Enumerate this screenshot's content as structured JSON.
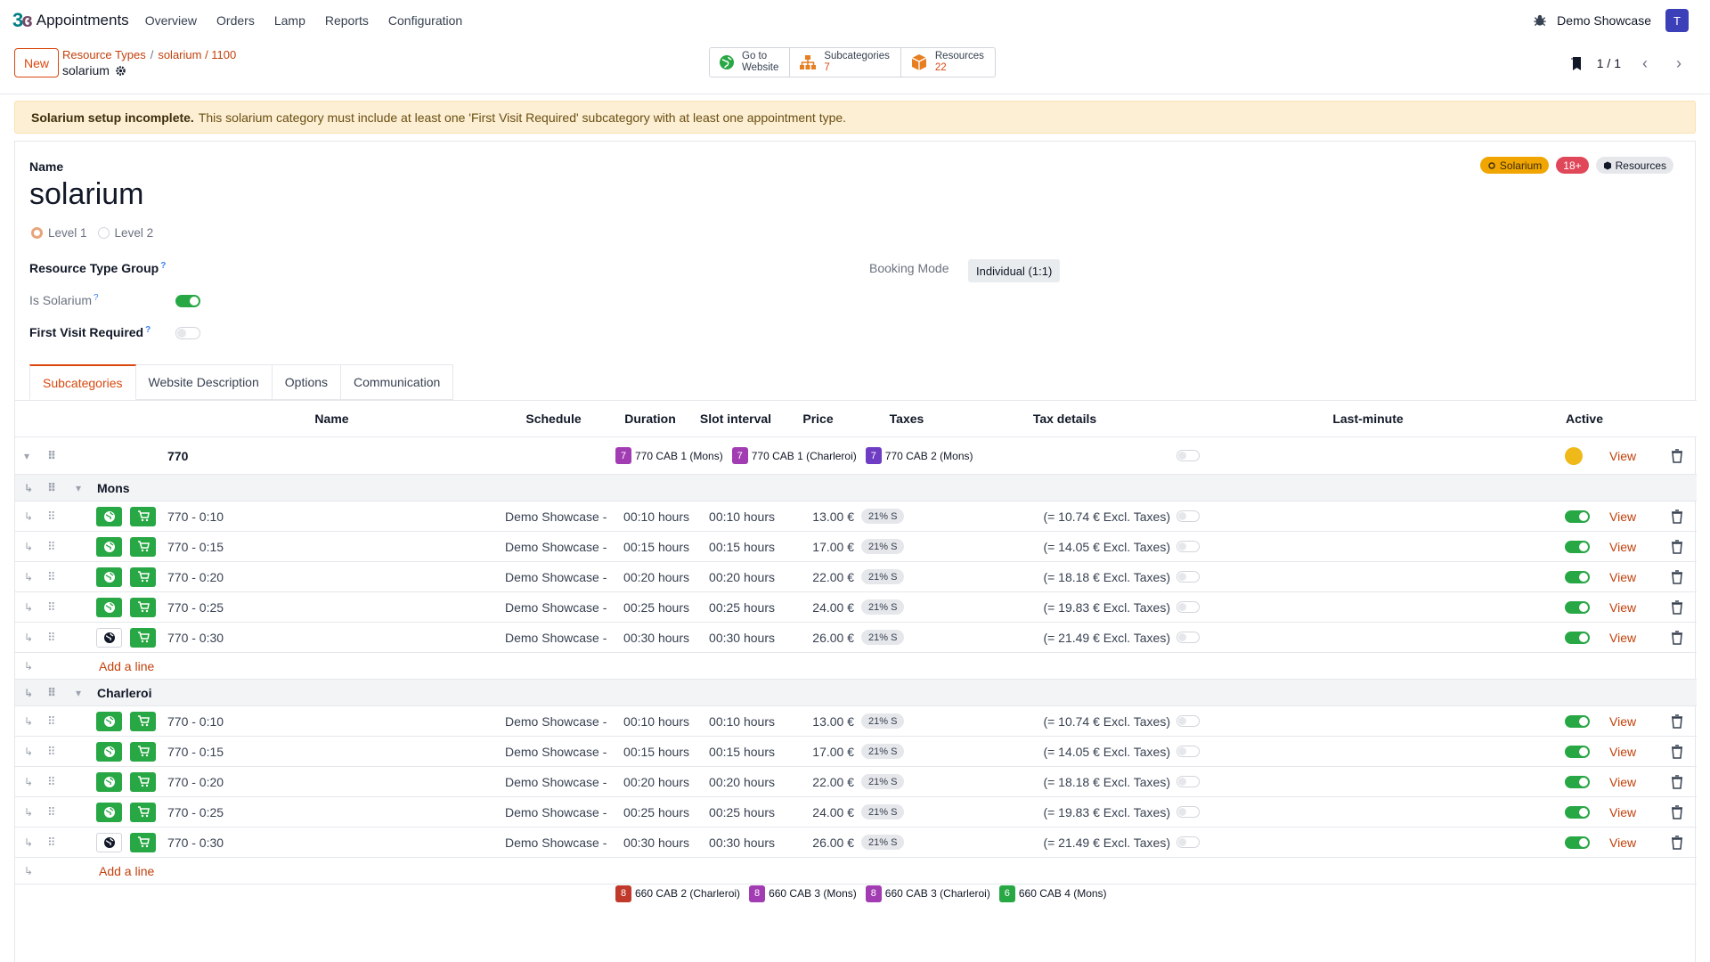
{
  "app": {
    "name": "Appointments",
    "menu": [
      "Overview",
      "Orders",
      "Lamp",
      "Reports",
      "Configuration"
    ],
    "company": "Demo Showcase",
    "user_initial": "T"
  },
  "control": {
    "new_label": "New",
    "breadcrumb": [
      "Resource Types",
      "solarium / 1100"
    ],
    "breadcrumb_sep": "/",
    "record_name": "solarium",
    "smart_buttons": [
      {
        "label": "Go to",
        "label2": "Website",
        "icon": "globe-icon"
      },
      {
        "label": "Subcategories",
        "count": "7",
        "icon": "sitemap-icon"
      },
      {
        "label": "Resources",
        "count": "22",
        "icon": "cube-icon"
      }
    ],
    "pager": "1 / 1"
  },
  "alert": {
    "title": "Solarium setup incomplete.",
    "message": "This solarium category must include at least one 'First Visit Required' subcategory with at least one appointment type."
  },
  "form": {
    "name_label": "Name",
    "name_value": "solarium",
    "level_options": [
      "Level 1",
      "Level 2"
    ],
    "level_selected": "Level 1",
    "badges": [
      {
        "label": "Solarium",
        "bg": "#f0a500",
        "fg": "#3d2e0b",
        "icon": "sun-icon"
      },
      {
        "label": "18+",
        "bg": "#e0485a",
        "fg": "#ffffff"
      },
      {
        "label": "Resources",
        "bg": "#e5e7eb",
        "fg": "#111827",
        "icon": "cube-icon"
      }
    ],
    "resource_type_group_label": "Resource Type Group",
    "is_solarium_label": "Is Solarium",
    "is_solarium": true,
    "first_visit_label": "First Visit Required",
    "first_visit": false,
    "booking_mode_label": "Booking Mode",
    "booking_mode_value": "Individual (1:1)",
    "help_mark": "?"
  },
  "tabs": [
    "Subcategories",
    "Website Description",
    "Options",
    "Communication"
  ],
  "active_tab": "Subcategories",
  "grid": {
    "headers": {
      "name": "Name",
      "schedule": "Schedule",
      "duration": "Duration",
      "slot_interval": "Slot interval",
      "price": "Price",
      "taxes": "Taxes",
      "tax_details": "Tax details",
      "last_minute": "Last-minute",
      "active": "Active"
    },
    "group": {
      "name": "770",
      "resources": [
        {
          "num": "7",
          "label": "770 CAB 1 (Mons)",
          "color": "#a23cb2"
        },
        {
          "num": "7",
          "label": "770 CAB 1 (Charleroi)",
          "color": "#a23cb2"
        },
        {
          "num": "7",
          "label": "770 CAB 2 (Mons)",
          "color": "#6f3cc4"
        }
      ],
      "active_color": "#f0b91a",
      "view": "View"
    },
    "sections": [
      {
        "name": "Mons",
        "rows": [
          {
            "name": "770 - 0:10",
            "schedule": "Demo Showcase -",
            "duration": "00:10 hours",
            "slot": "00:10 hours",
            "price": "13.00 €",
            "tax": "21% S",
            "tax_details": "(= 10.74 € Excl. Taxes)",
            "website_published": true,
            "active": true,
            "view": "View"
          },
          {
            "name": "770 - 0:15",
            "schedule": "Demo Showcase -",
            "duration": "00:15 hours",
            "slot": "00:15 hours",
            "price": "17.00 €",
            "tax": "21% S",
            "tax_details": "(= 14.05 € Excl. Taxes)",
            "website_published": true,
            "active": true,
            "view": "View"
          },
          {
            "name": "770 - 0:20",
            "schedule": "Demo Showcase -",
            "duration": "00:20 hours",
            "slot": "00:20 hours",
            "price": "22.00 €",
            "tax": "21% S",
            "tax_details": "(= 18.18 € Excl. Taxes)",
            "website_published": true,
            "active": true,
            "view": "View"
          },
          {
            "name": "770 - 0:25",
            "schedule": "Demo Showcase -",
            "duration": "00:25 hours",
            "slot": "00:25 hours",
            "price": "24.00 €",
            "tax": "21% S",
            "tax_details": "(= 19.83 € Excl. Taxes)",
            "website_published": true,
            "active": true,
            "view": "View"
          },
          {
            "name": "770 - 0:30",
            "schedule": "Demo Showcase -",
            "duration": "00:30 hours",
            "slot": "00:30 hours",
            "price": "26.00 €",
            "tax": "21% S",
            "tax_details": "(= 21.49 € Excl. Taxes)",
            "website_published": false,
            "active": true,
            "view": "View"
          }
        ],
        "add_line": "Add a line"
      },
      {
        "name": "Charleroi",
        "rows": [
          {
            "name": "770 - 0:10",
            "schedule": "Demo Showcase -",
            "duration": "00:10 hours",
            "slot": "00:10 hours",
            "price": "13.00 €",
            "tax": "21% S",
            "tax_details": "(= 10.74 € Excl. Taxes)",
            "website_published": true,
            "active": true,
            "view": "View"
          },
          {
            "name": "770 - 0:15",
            "schedule": "Demo Showcase -",
            "duration": "00:15 hours",
            "slot": "00:15 hours",
            "price": "17.00 €",
            "tax": "21% S",
            "tax_details": "(= 14.05 € Excl. Taxes)",
            "website_published": true,
            "active": true,
            "view": "View"
          },
          {
            "name": "770 - 0:20",
            "schedule": "Demo Showcase -",
            "duration": "00:20 hours",
            "slot": "00:20 hours",
            "price": "22.00 €",
            "tax": "21% S",
            "tax_details": "(= 18.18 € Excl. Taxes)",
            "website_published": true,
            "active": true,
            "view": "View"
          },
          {
            "name": "770 - 0:25",
            "schedule": "Demo Showcase -",
            "duration": "00:25 hours",
            "slot": "00:25 hours",
            "price": "24.00 €",
            "tax": "21% S",
            "tax_details": "(= 19.83 € Excl. Taxes)",
            "website_published": true,
            "active": true,
            "view": "View"
          },
          {
            "name": "770 - 0:30",
            "schedule": "Demo Showcase -",
            "duration": "00:30 hours",
            "slot": "00:30 hours",
            "price": "26.00 €",
            "tax": "21% S",
            "tax_details": "(= 21.49 € Excl. Taxes)",
            "website_published": false,
            "active": true,
            "view": "View"
          }
        ],
        "add_line": "Add a line"
      }
    ],
    "next_group_resources": [
      {
        "num": "8",
        "label": "660 CAB 2 (Charleroi)",
        "color": "#c0392b"
      },
      {
        "num": "8",
        "label": "660 CAB 3 (Mons)",
        "color": "#a23cb2"
      },
      {
        "num": "8",
        "label": "660 CAB 3 (Charleroi)",
        "color": "#a23cb2"
      },
      {
        "num": "6",
        "label": "660 CAB 4 (Mons)",
        "color": "#28a745"
      }
    ]
  }
}
